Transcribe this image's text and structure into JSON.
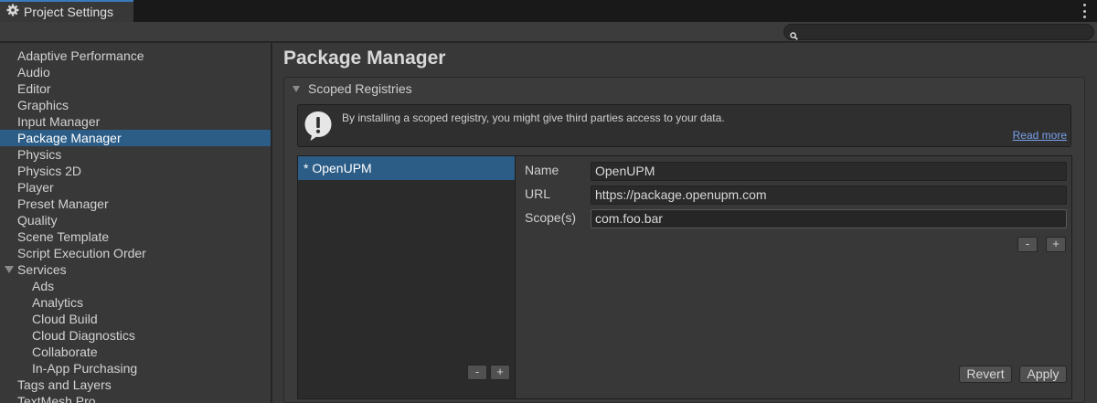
{
  "window": {
    "tab_title": "Project Settings",
    "tab_icon": "gear-icon",
    "menu_icon": "kebab-menu-icon"
  },
  "search": {
    "placeholder": "",
    "icon": "search-icon"
  },
  "sidebar": {
    "items": [
      {
        "label": "Adaptive Performance"
      },
      {
        "label": "Audio"
      },
      {
        "label": "Editor"
      },
      {
        "label": "Graphics"
      },
      {
        "label": "Input Manager"
      },
      {
        "label": "Package Manager",
        "selected": true
      },
      {
        "label": "Physics"
      },
      {
        "label": "Physics 2D"
      },
      {
        "label": "Player"
      },
      {
        "label": "Preset Manager"
      },
      {
        "label": "Quality"
      },
      {
        "label": "Scene Template"
      },
      {
        "label": "Script Execution Order"
      },
      {
        "label": "Services",
        "expanded": true
      },
      {
        "label": "Ads",
        "child": true
      },
      {
        "label": "Analytics",
        "child": true
      },
      {
        "label": "Cloud Build",
        "child": true
      },
      {
        "label": "Cloud Diagnostics",
        "child": true
      },
      {
        "label": "Collaborate",
        "child": true
      },
      {
        "label": "In-App Purchasing",
        "child": true
      },
      {
        "label": "Tags and Layers"
      },
      {
        "label": "TextMesh Pro"
      }
    ]
  },
  "main": {
    "title": "Package Manager",
    "section": {
      "title": "Scoped Registries",
      "warning": {
        "text": "By installing a scoped registry, you might give third parties access to your data.",
        "link": "Read more"
      },
      "registries": [
        {
          "label": "* OpenUPM"
        }
      ],
      "list_remove": "-",
      "list_add": "+",
      "fields": {
        "name_label": "Name",
        "name_value": "OpenUPM",
        "url_label": "URL",
        "url_value": "https://package.openupm.com",
        "scopes_label": "Scope(s)",
        "scopes_value": "com.foo.bar"
      },
      "scope_remove": "-",
      "scope_add": "+",
      "revert_label": "Revert",
      "apply_label": "Apply"
    }
  },
  "colors": {
    "selection": "#2c5d87",
    "link": "#7aa0ea",
    "background": "#383838"
  }
}
